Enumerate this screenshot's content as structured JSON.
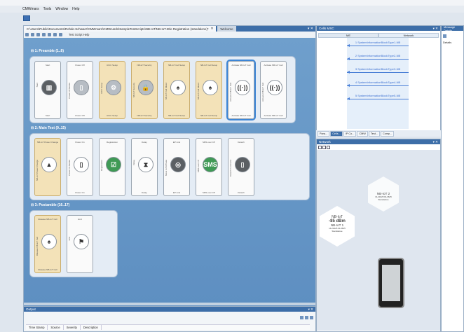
{
  "menu": {
    "items": [
      "CMWmars",
      "Tools",
      "Window",
      "Help"
    ]
  },
  "editor": {
    "path_tab": "C:\\Users\\Public\\Documents\\Rohde-Schwarz\\CMWmars\\CMWcards\\SampleTestScripts\\NB-IoT\\NB-IoT-IEle Registration (standalone)*",
    "tab_close": "✕",
    "welcome_tab": "Welcome",
    "toolbar_label": "Test Script Help",
    "groups": [
      {
        "title": "1: Preamble (1..8)",
        "cards": [
          {
            "top": "Start",
            "side": "Start",
            "bottom": "Start",
            "icon": "server-icon",
            "glyph": "▥",
            "style": "dark",
            "tan": false
          },
          {
            "top": "Power Off",
            "side": "Power Off Mobile",
            "bottom": "Power Off",
            "icon": "phone-off-icon",
            "glyph": "▯",
            "style": "",
            "tan": false
          },
          {
            "top": "UICC Setup",
            "side": "UICC Setup",
            "bottom": "UICC Setup",
            "icon": "gear-icon",
            "glyph": "⚙",
            "style": "",
            "tan": true
          },
          {
            "top": "NB-IoT Security",
            "side": "NB-IoT Security",
            "bottom": "NB-IoT Security",
            "icon": "lock-icon",
            "glyph": "🔒",
            "style": "",
            "tan": true
          },
          {
            "top": "NB-IoT Cell Setup",
            "side": "NB-IoT Cell Mixed",
            "bottom": "NB-IoT Cell Setup",
            "icon": "tower-icon",
            "glyph": "♠",
            "style": "white",
            "tan": true
          },
          {
            "top": "NB-IoT Cell Setup",
            "side": "NB-IoT Cell Mixed",
            "bottom": "NB-IoT Cell Setup",
            "icon": "tower-icon",
            "glyph": "♠",
            "style": "white",
            "tan": true
          },
          {
            "top": "Activate NB-IoT Cell",
            "side": "Activate NB-IoT Cell",
            "bottom": "Activate NB-IoT Cell",
            "icon": "antenna-icon",
            "glyph": "((·))",
            "style": "white",
            "tan": false,
            "selected": true
          },
          {
            "top": "Activate NB-IoT Cell",
            "side": "Activate NB-IoT Cell",
            "bottom": "Activate NB-IoT Cell",
            "icon": "antenna-icon",
            "glyph": "((·))",
            "style": "white",
            "tan": false
          }
        ]
      },
      {
        "title": "2: Main Test (9..15)",
        "cards": [
          {
            "top": "NB-IoT Power Change",
            "side": "NB-IoT Power Change",
            "bottom": "",
            "icon": "signal-tower-icon",
            "glyph": "▲",
            "style": "white",
            "tan": true
          },
          {
            "top": "Power On",
            "side": "Power On Mobile",
            "bottom": "Power On",
            "icon": "phone-icon",
            "glyph": "▯",
            "style": "white",
            "tan": false
          },
          {
            "top": "Registration",
            "side": "Registration",
            "bottom": "",
            "icon": "checklist-icon",
            "glyph": "☑",
            "style": "green",
            "tan": false
          },
          {
            "top": "Delay",
            "side": "Delay",
            "bottom": "Delay",
            "icon": "hourglass-icon",
            "glyph": "⧗",
            "style": "white",
            "tan": false
          },
          {
            "top": "EP Link",
            "side": "Move to B-Phase",
            "bottom": "EP Link",
            "icon": "globe-icon",
            "glyph": "◎",
            "style": "dark",
            "tan": false
          },
          {
            "top": "SMS over CP",
            "side": "SMS over CP",
            "bottom": "SMS over CP",
            "icon": "sms-icon",
            "glyph": "SMS",
            "style": "green",
            "tan": false
          },
          {
            "top": "Detach",
            "side": "Detach Command",
            "bottom": "Detach",
            "icon": "phone-detach-icon",
            "glyph": "▯",
            "style": "dark",
            "tan": false
          }
        ]
      },
      {
        "title": "3: Postamble (16..17)",
        "cards": [
          {
            "top": "Release NB-IoT Cell",
            "side": "Release NB-IoT Cell",
            "bottom": "Release NB-IoT Cell",
            "icon": "tower-icon",
            "glyph": "♠",
            "style": "white",
            "tan": true
          },
          {
            "top": "End",
            "side": "End",
            "bottom": "",
            "icon": "checkered-flag-icon",
            "glyph": "⚑",
            "style": "white",
            "tan": false
          }
        ]
      }
    ]
  },
  "output": {
    "title": "Output",
    "columns": [
      "Time Stamp",
      "Source",
      "Severity",
      "Description"
    ]
  },
  "msc": {
    "title": "Cells MSC",
    "col_me": "ME",
    "col_network": "Network",
    "messages": [
      "1 SystemInformationBlockType1-NB",
      "2 SystemInformationBlockType2-NB",
      "3 SystemInformationBlockType3-NB",
      "4 SystemInformationBlockType4-NB",
      "5 SystemInformationBlockType5-NB"
    ]
  },
  "dock_tabs": [
    "Para...",
    "Cells...",
    "IP Co...",
    "CMW",
    "Test...",
    "Comp..."
  ],
  "network": {
    "title": "Network",
    "cell1": {
      "name": "NB-IoT",
      "power": "-85 dBm",
      "label": "NB-IoT 1",
      "earfcn": "UL23425 DL3625",
      "mode": "Standalone"
    },
    "cell2": {
      "name": "NB-IoT 2",
      "earfcn": "UL23425 DL3625",
      "mode": "Standalone"
    }
  },
  "details": {
    "title": "Message Details",
    "sub": "Details"
  },
  "colors": {
    "accent": "#3d6ea8",
    "canvas": "#6f9fcc",
    "msg": "#4a7fd6"
  }
}
